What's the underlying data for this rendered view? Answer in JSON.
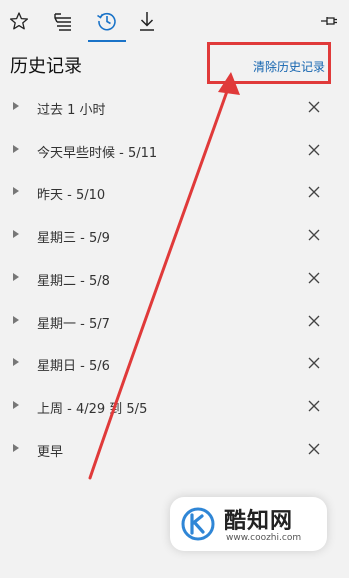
{
  "toolbar": {
    "buttons": [
      {
        "icon": "star-icon"
      },
      {
        "icon": "reading-list-icon"
      },
      {
        "icon": "history-icon",
        "active": true
      },
      {
        "icon": "download-icon"
      }
    ],
    "pin_icon": "pin-icon",
    "accent_color": "#1a73c8"
  },
  "panel": {
    "title": "历史记录",
    "clear_label": "清除历史记录"
  },
  "history_groups": [
    {
      "label": "过去 1 小时"
    },
    {
      "label": "今天早些时候 - 5/11"
    },
    {
      "label": "昨天 - 5/10"
    },
    {
      "label": "星期三 - 5/9"
    },
    {
      "label": "星期二 - 5/8"
    },
    {
      "label": "星期一 - 5/7"
    },
    {
      "label": "星期日 - 5/6"
    },
    {
      "label": "上周 - 4/29 到 5/5"
    },
    {
      "label": "更早"
    }
  ],
  "annotation": {
    "color": "#e03a3a"
  },
  "watermark": {
    "name": "酷知网",
    "url": "www.coozhi.com"
  }
}
